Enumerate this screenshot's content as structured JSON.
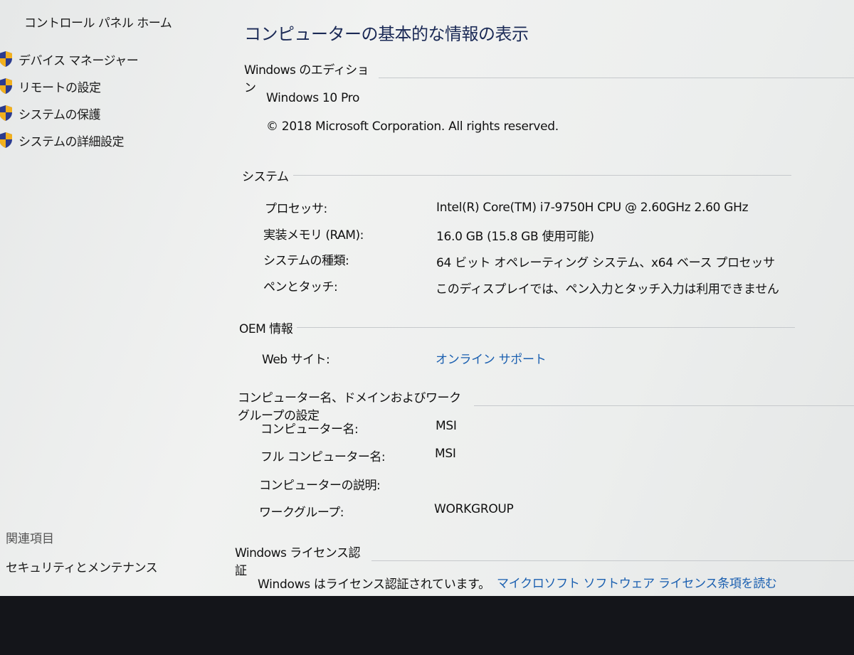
{
  "left_pane": {
    "home_link": "コントロール パネル ホーム",
    "tasks": [
      {
        "label": "デバイス マネージャー",
        "icon": "shield-icon"
      },
      {
        "label": "リモートの設定",
        "icon": "shield-icon"
      },
      {
        "label": "システムの保護",
        "icon": "shield-icon"
      },
      {
        "label": "システムの詳細設定",
        "icon": "shield-icon"
      }
    ],
    "related_title": "関連項目",
    "related_link": "セキュリティとメンテナンス"
  },
  "main": {
    "title": "コンピューターの基本的な情報の表示",
    "edition": {
      "heading": "Windows のエディション",
      "name": "Windows 10 Pro",
      "copyright": "© 2018 Microsoft Corporation. All rights reserved."
    },
    "system": {
      "heading": "システム",
      "rows": [
        {
          "label": "プロセッサ:",
          "value": "Intel(R) Core(TM) i7-9750H CPU @ 2.60GHz   2.60 GHz"
        },
        {
          "label": "実装メモリ (RAM):",
          "value": "16.0 GB (15.8 GB 使用可能)"
        },
        {
          "label": "システムの種類:",
          "value": "64 ビット オペレーティング システム、x64 ベース プロセッサ"
        },
        {
          "label": "ペンとタッチ:",
          "value": "このディスプレイでは、ペン入力とタッチ入力は利用できません"
        }
      ]
    },
    "oem": {
      "heading": "OEM 情報",
      "web_label": "Web サイト:",
      "web_link": "オンライン サポート"
    },
    "computer_name": {
      "heading": "コンピューター名、ドメインおよびワークグループの設定",
      "rows": [
        {
          "label": "コンピューター名:",
          "value": "MSI"
        },
        {
          "label": "フル コンピューター名:",
          "value": "MSI"
        },
        {
          "label": "コンピューターの説明:",
          "value": ""
        },
        {
          "label": "ワークグループ:",
          "value": "WORKGROUP"
        }
      ]
    },
    "activation": {
      "heading": "Windows ライセンス認証",
      "status": "Windows はライセンス認証されています。",
      "license_link": "マイクロソフト ソフトウェア ライセンス条項を読む"
    }
  },
  "colors": {
    "link": "#1a5fb0",
    "title": "#1b2a56",
    "bezel": "#14151a"
  }
}
